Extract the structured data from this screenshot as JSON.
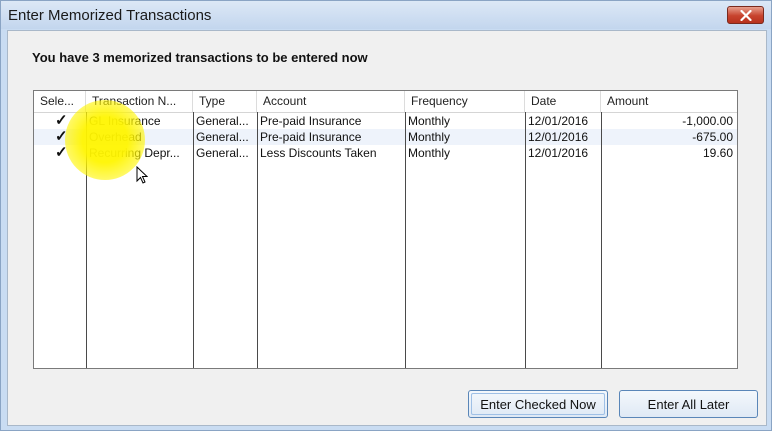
{
  "window": {
    "title": "Enter Memorized Transactions"
  },
  "message": "You have 3 memorized transactions to be entered now",
  "table": {
    "columns": [
      "Sele...",
      "Transaction N...",
      "Type",
      "Account",
      "Frequency",
      "Date",
      "Amount"
    ],
    "rows": [
      {
        "selected": "✓",
        "name": "GL Insurance",
        "type": "General...",
        "account": "Pre-paid Insurance",
        "frequency": "Monthly",
        "date": "12/01/2016",
        "amount": "-1,000.00"
      },
      {
        "selected": "✓",
        "name": "Overhead",
        "type": "General...",
        "account": "Pre-paid Insurance",
        "frequency": "Monthly",
        "date": "12/01/2016",
        "amount": "-675.00"
      },
      {
        "selected": "✓",
        "name": "Recurring Depr...",
        "type": "General...",
        "account": "Less Discounts Taken",
        "frequency": "Monthly",
        "date": "12/01/2016",
        "amount": "19.60"
      }
    ]
  },
  "buttons": {
    "enter_checked": "Enter Checked Now",
    "enter_later": "Enter All Later"
  },
  "icons": {
    "close": "close-icon",
    "check": "checkmark-icon",
    "cursor": "mouse-pointer-icon"
  },
  "colors": {
    "close_button": "#c7432e",
    "highlight": "#fff500"
  }
}
